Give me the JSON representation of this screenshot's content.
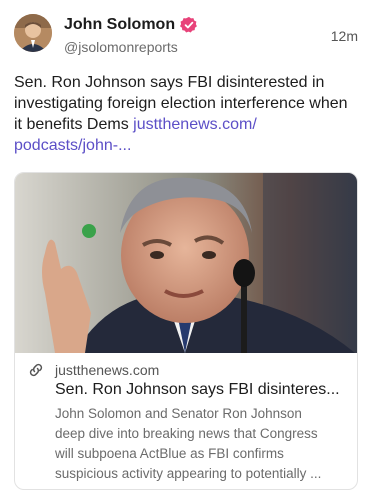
{
  "post": {
    "author": {
      "display_name": "John Solomon",
      "handle": "@jsolomonreports",
      "verified": true,
      "verified_color": "#e8437a"
    },
    "timestamp": "12m",
    "text": "Sen. Ron Johnson says FBI disinterested in investigating foreign election interference when it benefits Dems ",
    "link_text_line1": "justthenews.com/",
    "link_text_line2": "podcasts/john-...",
    "link_color": "#5c4fc7",
    "link_card": {
      "image_alt": "photo-of-man-speaking-at-microphone",
      "link_icon": "link-icon",
      "domain": "justthenews.com",
      "title": "Sen. Ron Johnson says FBI disinteres...",
      "description_lines": [
        "John Solomon and Senator Ron Johnson",
        "deep dive into breaking news that Congress",
        "will subpoena ActBlue as FBI confirms",
        "suspicious activity appearing to potentially ..."
      ]
    }
  }
}
